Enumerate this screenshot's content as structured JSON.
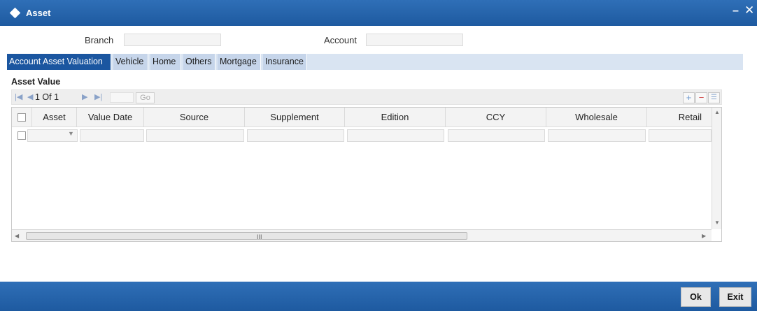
{
  "window": {
    "title": "Asset",
    "minimize_glyph": "–",
    "close_glyph": "✕"
  },
  "header": {
    "branch_label": "Branch",
    "branch_value": "",
    "account_label": "Account",
    "account_value": ""
  },
  "tabs": [
    {
      "label": "Account Asset Valuation",
      "active": true
    },
    {
      "label": "Vehicle",
      "active": false
    },
    {
      "label": "Home",
      "active": false
    },
    {
      "label": "Others",
      "active": false
    },
    {
      "label": "Mortgage",
      "active": false
    },
    {
      "label": "Insurance",
      "active": false
    }
  ],
  "section": {
    "title": "Asset Value"
  },
  "pager": {
    "text": "1 Of 1",
    "page_input": "",
    "go_label": "Go"
  },
  "grid": {
    "columns": [
      "Asset",
      "Value Date",
      "Source",
      "Supplement",
      "Edition",
      "CCY",
      "Wholesale",
      "Retail"
    ],
    "rows": [
      {
        "asset": "",
        "value_date": "",
        "source": "",
        "supplement": "",
        "edition": "",
        "ccy": "",
        "wholesale": "",
        "retail": ""
      }
    ],
    "scroll_grip": "III"
  },
  "footer": {
    "ok_label": "Ok",
    "exit_label": "Exit"
  }
}
